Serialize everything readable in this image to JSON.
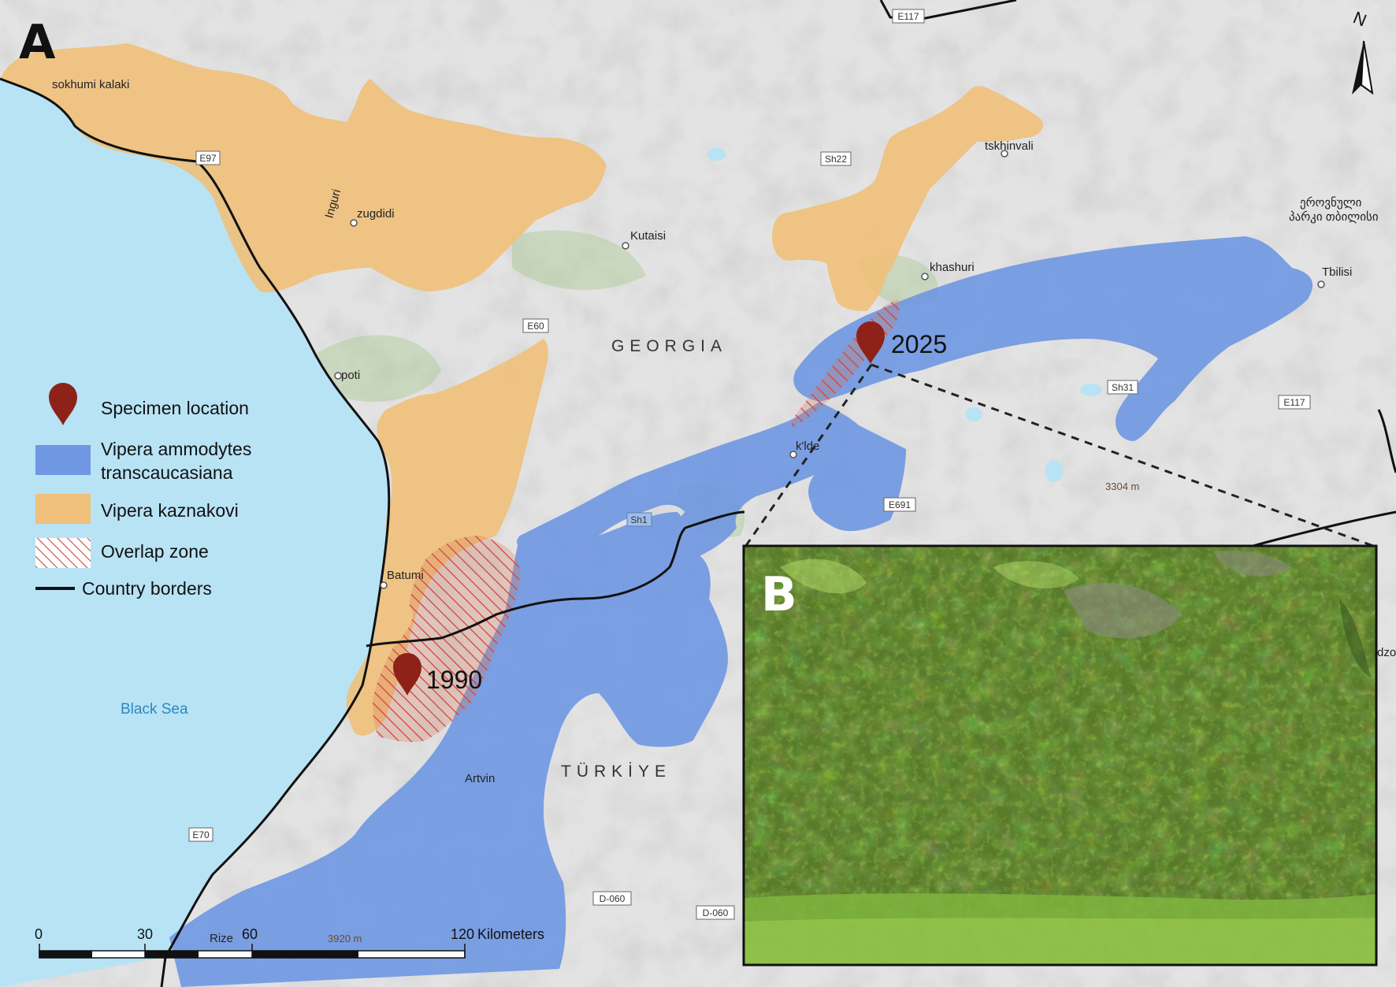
{
  "panels": {
    "a": "A",
    "b": "B"
  },
  "north_arrow": {
    "label": "N"
  },
  "countries": [
    {
      "key": "georgia",
      "name": "GEORGIA"
    },
    {
      "key": "turkiye",
      "name": "TÜRKİYE"
    }
  ],
  "water": {
    "black_sea": "Black Sea"
  },
  "places": [
    {
      "key": "sokhumi",
      "name": "sokhumi kalaki"
    },
    {
      "key": "zugdidi",
      "name": "zugdidi"
    },
    {
      "key": "inguri",
      "name": "Inguri"
    },
    {
      "key": "kutaisi",
      "name": "Kutaisi"
    },
    {
      "key": "tskhinvali",
      "name": "tskhinvali"
    },
    {
      "key": "khashuri",
      "name": "khashuri"
    },
    {
      "key": "tbilisi",
      "name": "Tbilisi"
    },
    {
      "key": "poti",
      "name": "poti"
    },
    {
      "key": "batumi",
      "name": "Batumi"
    },
    {
      "key": "klde",
      "name": "k'lde"
    },
    {
      "key": "artvin",
      "name": "Artvin"
    },
    {
      "key": "rize",
      "name": "Rize"
    },
    {
      "key": "park1",
      "name": "ეროვნული"
    },
    {
      "key": "park2",
      "name": "პარკი თბილისი"
    },
    {
      "key": "edge",
      "name": "dzo"
    }
  ],
  "elevations": [
    {
      "key": "e1",
      "label": "3304 m"
    },
    {
      "key": "e2",
      "label": "3920 m"
    }
  ],
  "roads": [
    {
      "key": "e117a",
      "label": "E117"
    },
    {
      "key": "e97",
      "label": "E97"
    },
    {
      "key": "sh22",
      "label": "Sh22"
    },
    {
      "key": "e60",
      "label": "E60"
    },
    {
      "key": "sh31",
      "label": "Sh31"
    },
    {
      "key": "e117b",
      "label": "E117"
    },
    {
      "key": "e691",
      "label": "E691"
    },
    {
      "key": "sh1",
      "label": "Sh1"
    },
    {
      "key": "e70",
      "label": "E70"
    },
    {
      "key": "d060a",
      "label": "D-060"
    },
    {
      "key": "d060b",
      "label": "D-060"
    }
  ],
  "specimens": [
    {
      "key": "s2025",
      "year": "2025"
    },
    {
      "key": "s1990",
      "year": "1990"
    }
  ],
  "legend": {
    "specimen": "Specimen location",
    "vat_line1": "Vipera ammodytes",
    "vat_line2": "transcaucasiana",
    "vk": "Vipera kaznakovi",
    "overlap": "Overlap zone",
    "borders": "Country borders"
  },
  "scale_bar": {
    "unit": "Kilometers",
    "ticks": [
      "0",
      "30",
      "60",
      "120"
    ]
  },
  "colors": {
    "land": "#e3e3e3",
    "sea": "#b8e3f5",
    "vipera_ammodytes_transcaucasiana": "#6f97e2",
    "vipera_kaznakovi": "#efc07a",
    "overlap_hatch": "#d2453a",
    "marker": "#8e2218",
    "border": "#111111",
    "vegetation": "#9bc47a"
  },
  "photo": {
    "subject": "green shrubland hillside habitat"
  }
}
